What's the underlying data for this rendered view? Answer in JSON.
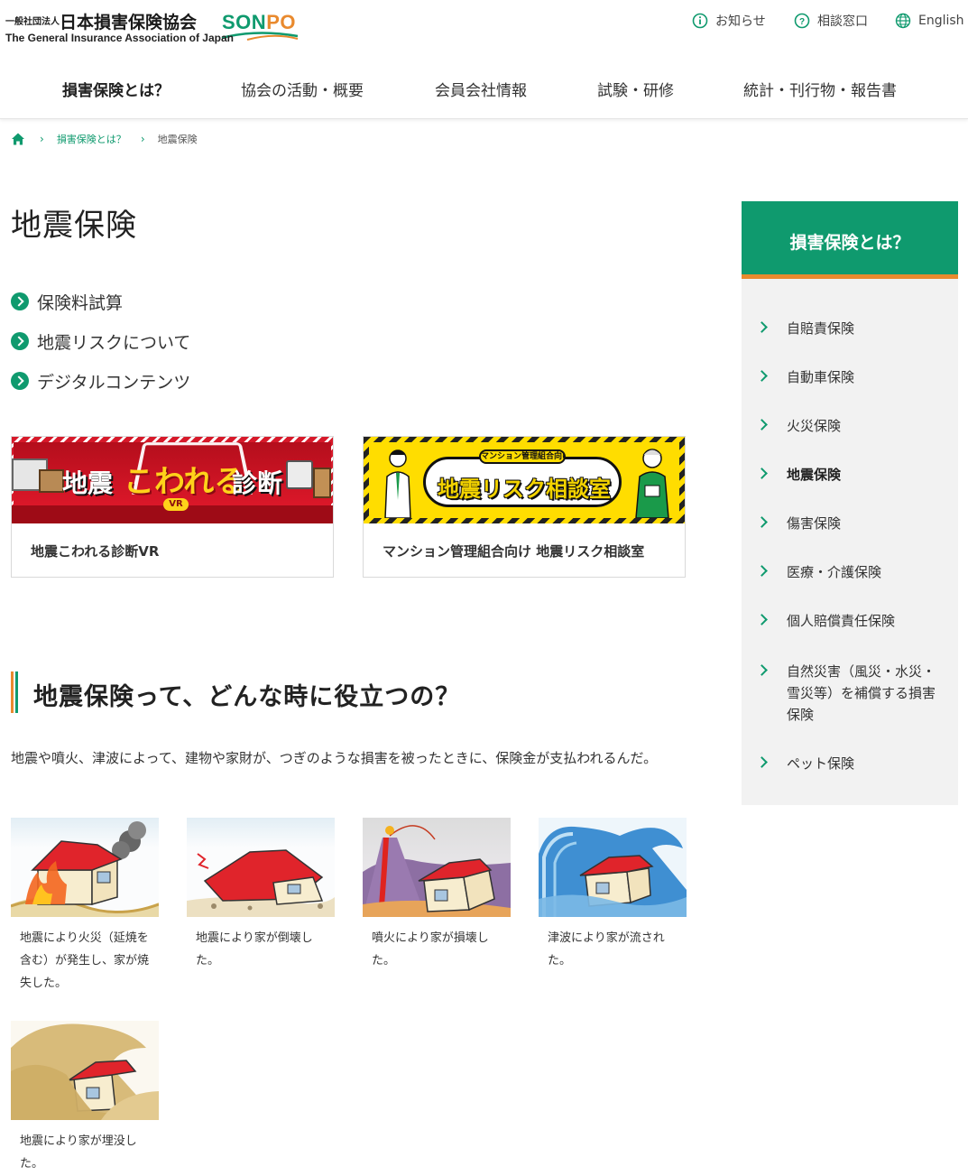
{
  "header": {
    "logo": {
      "prefix": "一般社団法人",
      "name": "日本損害保険協会",
      "brand_main": "SON",
      "brand_accent": "PO",
      "english": "The General Insurance Association of Japan"
    },
    "utility": {
      "news": "お知らせ",
      "consult": "相談窓口",
      "english": "English"
    },
    "nav": [
      {
        "label": "損害保険とは？",
        "active": true
      },
      {
        "label": "協会の活動・概要",
        "active": false
      },
      {
        "label": "会員会社情報",
        "active": false
      },
      {
        "label": "試験・研修",
        "active": false
      },
      {
        "label": "統計・刊行物・報告書",
        "active": false
      }
    ]
  },
  "breadcrumb": {
    "items": [
      "損害保険とは？",
      "地震保険"
    ]
  },
  "main": {
    "title": "地震保険",
    "anchors": [
      "保険料試算",
      "地震リスクについて",
      "デジタルコンテンツ"
    ],
    "cards": [
      {
        "label": "地震こわれる診断VR",
        "banner_text_1": "地震",
        "banner_text_2": "こわれる",
        "banner_text_3": "診断",
        "banner_badge": "VR"
      },
      {
        "label": "マンション管理組合向け 地震リスク相談室",
        "banner_tag": "マンション管理組合向け",
        "banner_main": "地震リスク相談室"
      }
    ],
    "section": {
      "heading": "地震保険って、どんな時に役立つの？",
      "intro": "地震や噴火、津波によって、建物や家財が、つぎのような損害を被ったときに、保険金が支払われるんだ。",
      "damages": [
        {
          "caption": "地震により火災（延焼を含む）が発生し、家が焼失した。"
        },
        {
          "caption": "地震により家が倒壊した。"
        },
        {
          "caption": "噴火により家が損壊した。"
        },
        {
          "caption": "津波により家が流された。"
        },
        {
          "caption": "地震により家が埋没した。"
        }
      ]
    }
  },
  "sidebar": {
    "heading": "損害保険とは？",
    "items": [
      {
        "label": "自賠責保険",
        "active": false
      },
      {
        "label": "自動車保険",
        "active": false
      },
      {
        "label": "火災保険",
        "active": false
      },
      {
        "label": "地震保険",
        "active": true
      },
      {
        "label": "傷害保険",
        "active": false
      },
      {
        "label": "医療・介護保険",
        "active": false
      },
      {
        "label": "個人賠償責任保険",
        "active": false
      },
      {
        "label": "自然災害（風災・水災・雪災等）を補償する損害保険",
        "active": false
      },
      {
        "label": "ペット保険",
        "active": false
      }
    ]
  },
  "colors": {
    "brand_green": "#0f9a6e",
    "brand_orange": "#e98a2e",
    "sidebar_bg": "#f2f2f2"
  }
}
